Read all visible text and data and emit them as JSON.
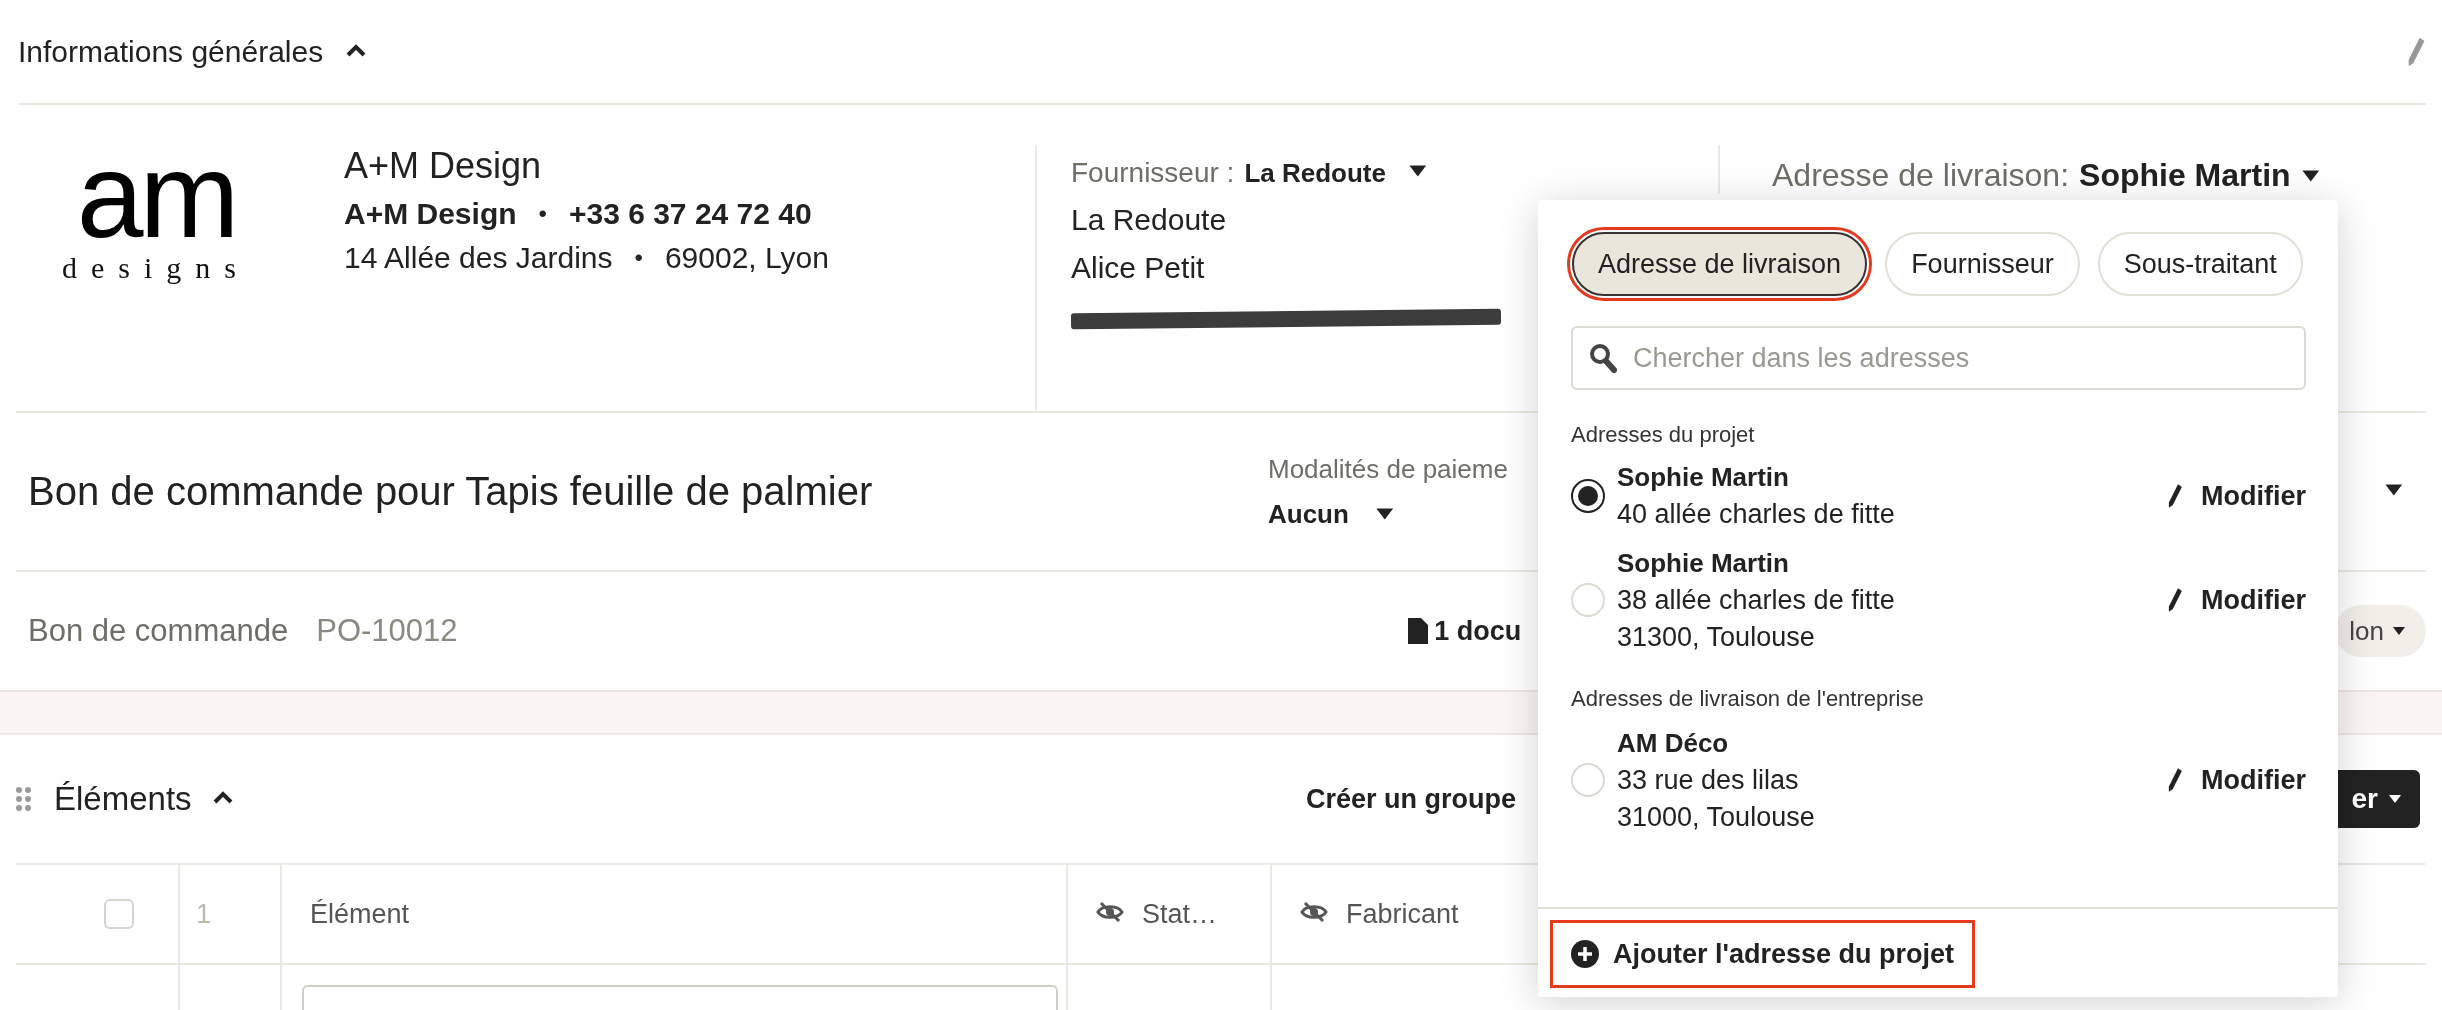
{
  "section_header": {
    "title": "Informations générales",
    "expanded": true
  },
  "company": {
    "logo_mark": "am",
    "logo_tagline": "designs",
    "name": "A+M Design",
    "contact": "A+M Design",
    "phone": "+33 6 37 24 72 40",
    "street": "14 Allée des Jardins",
    "city": "69002, Lyon",
    "separators": [
      "•",
      "•"
    ]
  },
  "supplier": {
    "label": "Fournisseur :",
    "value": "La Redoute",
    "lines": [
      "La Redoute",
      "Alice Petit"
    ],
    "email_redacted": true
  },
  "delivery": {
    "label": "Adresse de livraison:",
    "value": "Sophie Martin"
  },
  "order": {
    "title": "Bon de commande pour Tapis feuille de palmier",
    "payment_label": "Modalités de paieme",
    "payment_value": "Aucun",
    "number_label": "Bon de commande",
    "number": "PO-10012",
    "documents": "1 docu",
    "pill": "lon"
  },
  "elements": {
    "title": "Éléments",
    "expanded": true,
    "create_group": "Créer un groupe",
    "action_button": "er"
  },
  "table": {
    "select_all_checked": false,
    "row_number": "1",
    "columns": [
      {
        "label": "Élément",
        "hidden": false
      },
      {
        "label": "Stat…",
        "hidden": true
      },
      {
        "label": "Fabricant",
        "hidden": true
      }
    ]
  },
  "address_picker": {
    "tabs": [
      {
        "label": "Adresse de livraison",
        "selected": true,
        "highlighted": true
      },
      {
        "label": "Fournisseur",
        "selected": false,
        "highlighted": false
      },
      {
        "label": "Sous-traitant",
        "selected": false,
        "highlighted": false
      }
    ],
    "search": {
      "placeholder": "Chercher dans les adresses"
    },
    "groups": [
      {
        "title": "Adresses du projet",
        "addresses": [
          {
            "name": "Sophie Martin",
            "lines": [
              "40 allée charles de fitte"
            ],
            "selected": true,
            "action": "Modifier"
          },
          {
            "name": "Sophie Martin",
            "lines": [
              "38 allée charles de fitte",
              "31300, Toulouse"
            ],
            "selected": false,
            "action": "Modifier"
          }
        ]
      },
      {
        "title": "Adresses de livraison de l'entreprise",
        "addresses": [
          {
            "name": "AM Déco",
            "lines": [
              "33 rue des lilas",
              "31000, Toulouse"
            ],
            "selected": false,
            "action": "Modifier"
          }
        ]
      }
    ],
    "add_button": {
      "label": "Ajouter l'adresse du projet",
      "highlighted": true
    }
  }
}
